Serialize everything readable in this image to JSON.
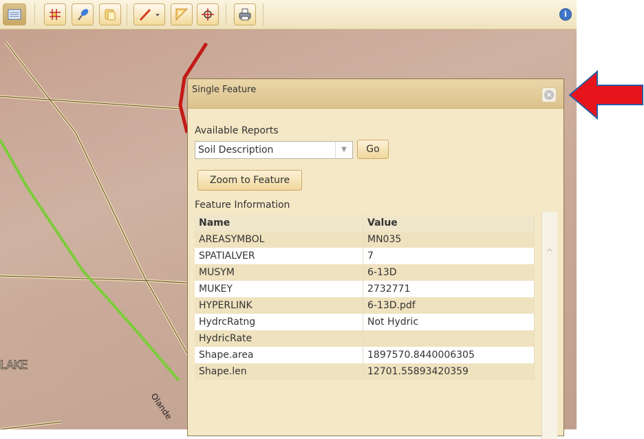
{
  "toolbar": {
    "buttons": [
      "layers-icon",
      "grid-icon",
      "pin-icon",
      "identify-icon",
      "draw-icon",
      "measure-icon",
      "target-icon",
      "print-icon",
      "info-icon"
    ]
  },
  "map": {
    "lake_label": "LAKE",
    "road_label": "Olande"
  },
  "popup": {
    "title": "Single Feature",
    "available_reports_label": "Available Reports",
    "report_select_value": "Soil Description",
    "go_label": "Go",
    "zoom_label": "Zoom to Feature",
    "feature_info_label": "Feature Information",
    "table": {
      "headers": [
        "Name",
        "Value"
      ],
      "rows": [
        [
          "AREASYMBOL",
          "MN035"
        ],
        [
          "SPATIALVER",
          "7"
        ],
        [
          "MUSYM",
          "6-13D"
        ],
        [
          "MUKEY",
          "2732771"
        ],
        [
          "HYPERLINK",
          "6-13D.pdf"
        ],
        [
          "HydrcRatng",
          "Not Hydric"
        ],
        [
          "HydricRate",
          ""
        ],
        [
          "Shape.area",
          "1897570.8440006305"
        ],
        [
          "Shape.len",
          "12701.55893420359"
        ]
      ]
    }
  },
  "colors": {
    "accent_arrow": "#e8141c",
    "boundary": "#c21a16",
    "road_green": "#7ccc3c"
  }
}
